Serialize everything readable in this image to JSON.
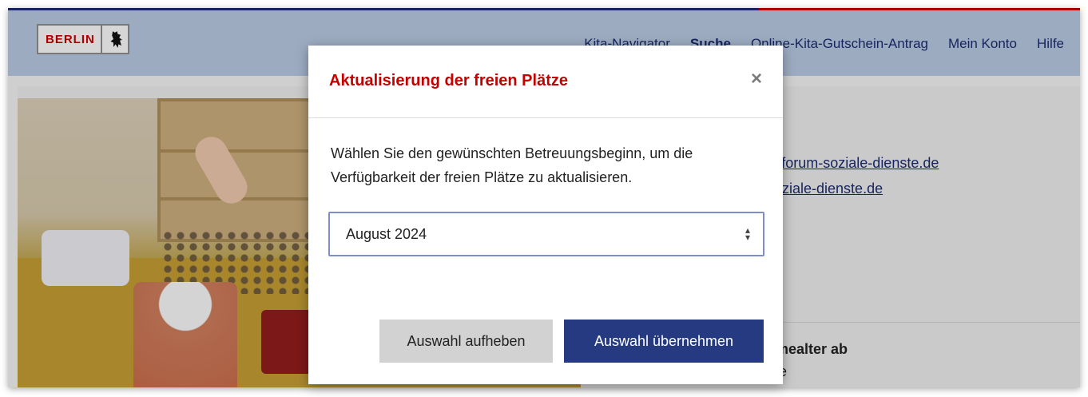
{
  "header": {
    "logo_text": "BERLIN",
    "nav": [
      "Kita-Navigator",
      "Suche",
      "Online-Kita-Gutschein-Antrag",
      "Mein Konto",
      "Hilfe"
    ],
    "active_nav": "Suche"
  },
  "background": {
    "email_1": "@forum-soziale-dienste.de",
    "email_2": "soziale-dienste.de",
    "info_label": "hmealter ab",
    "info_value": "ate"
  },
  "modal": {
    "title": "Aktualisierung der freien Plätze",
    "close_symbol": "×",
    "description": "Wählen Sie den gewünschten Betreuungsbeginn, um die Verfügbarkeit der freien Plätze zu aktualisieren.",
    "select_value": "August 2024",
    "button_clear": "Auswahl aufheben",
    "button_apply": "Auswahl übernehmen"
  },
  "colors": {
    "brand_red": "#c40000",
    "brand_blue": "#1b2a6b",
    "button_primary": "#253a80"
  }
}
